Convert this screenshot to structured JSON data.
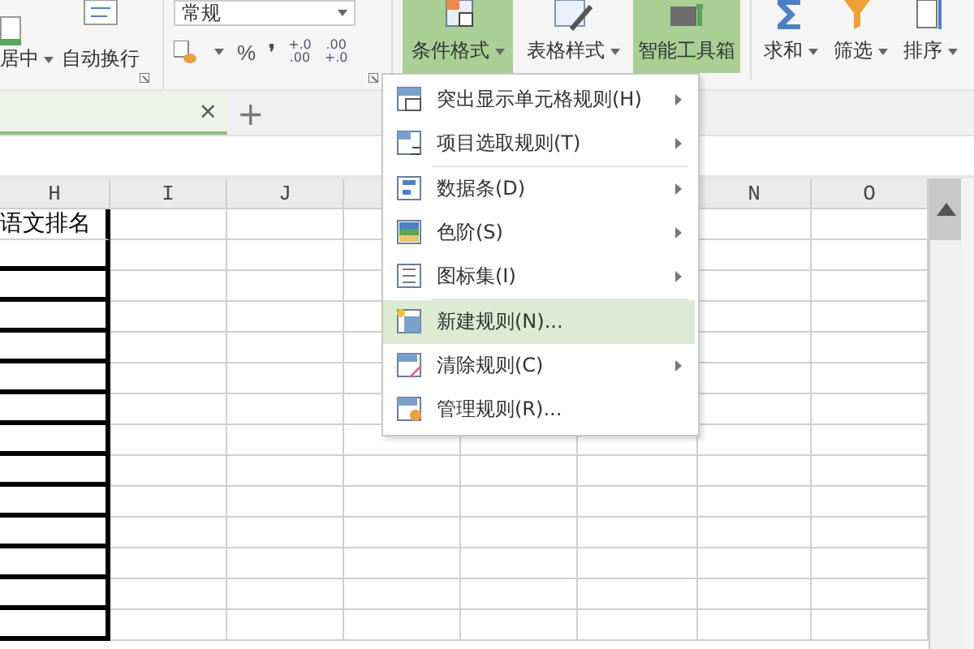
{
  "ribbon": {
    "align_group": {
      "merge_label": "居中",
      "wrap_label": "自动换行"
    },
    "number_group": {
      "format": "常规",
      "percent": "%",
      "comma": "❜",
      "increase": "+.0\n.00",
      "decrease": ".00\n+.0"
    },
    "buttons": [
      {
        "kind": "conditional",
        "label": "条件格式",
        "caret": true,
        "selected": true
      },
      {
        "kind": "table-style",
        "label": "表格样式",
        "caret": true,
        "selected": false
      },
      {
        "kind": "toolbox",
        "label": "智能工具箱",
        "caret": false,
        "selected": true
      },
      {
        "kind": "sum",
        "label": "求和",
        "caret": true,
        "selected": false
      },
      {
        "kind": "filter",
        "label": "筛选",
        "caret": true,
        "selected": false
      },
      {
        "kind": "sort",
        "label": "排序",
        "caret": true,
        "selected": false
      }
    ]
  },
  "sheet_tabs": {
    "close": "×",
    "add": "+"
  },
  "columns": [
    "H",
    "I",
    "J",
    null,
    null,
    null,
    "N",
    "O"
  ],
  "cells": {
    "h1": "语文排名"
  },
  "menu": [
    {
      "kind": "highlight",
      "label": "突出显示单元格规则(H)",
      "submenu": true,
      "selected": false
    },
    {
      "kind": "top",
      "label": "项目选取规则(T)",
      "submenu": true,
      "selected": false,
      "separator_after": true
    },
    {
      "kind": "databar",
      "label": "数据条(D)",
      "submenu": true,
      "selected": false
    },
    {
      "kind": "scale",
      "label": "色阶(S)",
      "submenu": true,
      "selected": false
    },
    {
      "kind": "iconset",
      "label": "图标集(I)",
      "submenu": true,
      "selected": false,
      "separator_after": true
    },
    {
      "kind": "new",
      "label": "新建规则(N)...",
      "submenu": false,
      "selected": true
    },
    {
      "kind": "clear",
      "label": "清除规则(C)",
      "submenu": true,
      "selected": false
    },
    {
      "kind": "manage",
      "label": "管理规则(R)...",
      "submenu": false,
      "selected": false
    }
  ]
}
